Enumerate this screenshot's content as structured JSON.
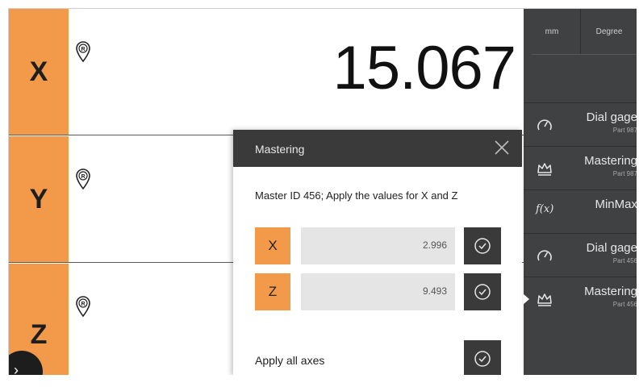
{
  "axes": [
    {
      "label": "X",
      "value": "15.067"
    },
    {
      "label": "Y",
      "value": ""
    },
    {
      "label": "Z",
      "value": ""
    }
  ],
  "sidebar": {
    "units": {
      "length": "mm",
      "angle": "Degree"
    },
    "items": [
      {
        "title": "Dial gage",
        "subtitle": "Part 987",
        "icon": "dial-gauge-icon"
      },
      {
        "title": "Mastering",
        "subtitle": "Part 987",
        "icon": "crown-icon"
      },
      {
        "title": "MinMax",
        "subtitle": "",
        "icon": "function-icon",
        "icon_text": "f(x)"
      },
      {
        "title": "Dial gage",
        "subtitle": "Part 456",
        "icon": "dial-gauge-icon"
      },
      {
        "title": "Mastering",
        "subtitle": "Part 456",
        "icon": "crown-icon",
        "active": true
      }
    ]
  },
  "dialog": {
    "title": "Mastering",
    "message": "Master ID 456; Apply the values for X and Z",
    "rows": [
      {
        "axis": "X",
        "value": "2.996"
      },
      {
        "axis": "Z",
        "value": "9.493"
      }
    ],
    "apply_all_label": "Apply all axes"
  },
  "colors": {
    "accent_orange": "#f39a4a",
    "sidebar_bg": "#3f4142",
    "dialog_header": "#3a3a3a",
    "field_bg": "#e5e5e5"
  }
}
